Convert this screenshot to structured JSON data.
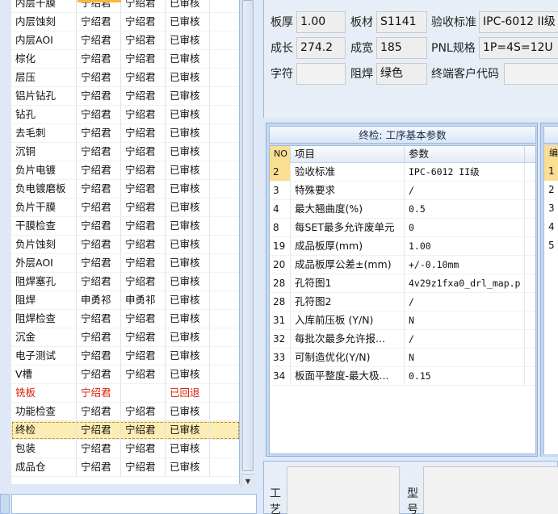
{
  "process_list": {
    "rows": [
      {
        "process": "内层干膜",
        "person1": "宁绍君",
        "person2": "宁绍君",
        "status": "已审核"
      },
      {
        "process": "内层蚀刻",
        "person1": "宁绍君",
        "person2": "宁绍君",
        "status": "已审核"
      },
      {
        "process": "内层AOI",
        "person1": "宁绍君",
        "person2": "宁绍君",
        "status": "已审核"
      },
      {
        "process": "棕化",
        "person1": "宁绍君",
        "person2": "宁绍君",
        "status": "已审核"
      },
      {
        "process": "层压",
        "person1": "宁绍君",
        "person2": "宁绍君",
        "status": "已审核"
      },
      {
        "process": "铝片钻孔",
        "person1": "宁绍君",
        "person2": "宁绍君",
        "status": "已审核"
      },
      {
        "process": "钻孔",
        "person1": "宁绍君",
        "person2": "宁绍君",
        "status": "已审核"
      },
      {
        "process": "去毛刺",
        "person1": "宁绍君",
        "person2": "宁绍君",
        "status": "已审核"
      },
      {
        "process": "沉铜",
        "person1": "宁绍君",
        "person2": "宁绍君",
        "status": "已审核"
      },
      {
        "process": "负片电镀",
        "person1": "宁绍君",
        "person2": "宁绍君",
        "status": "已审核"
      },
      {
        "process": "负电镀磨板",
        "person1": "宁绍君",
        "person2": "宁绍君",
        "status": "已审核"
      },
      {
        "process": "负片干膜",
        "person1": "宁绍君",
        "person2": "宁绍君",
        "status": "已审核"
      },
      {
        "process": "干膜检查",
        "person1": "宁绍君",
        "person2": "宁绍君",
        "status": "已审核"
      },
      {
        "process": "负片蚀刻",
        "person1": "宁绍君",
        "person2": "宁绍君",
        "status": "已审核"
      },
      {
        "process": "外层AOI",
        "person1": "宁绍君",
        "person2": "宁绍君",
        "status": "已审核"
      },
      {
        "process": "阻焊塞孔",
        "person1": "宁绍君",
        "person2": "宁绍君",
        "status": "已审核"
      },
      {
        "process": "阻焊",
        "person1": "申勇祁",
        "person2": "申勇祁",
        "status": "已审核"
      },
      {
        "process": "阻焊检查",
        "person1": "宁绍君",
        "person2": "宁绍君",
        "status": "已审核"
      },
      {
        "process": "沉金",
        "person1": "宁绍君",
        "person2": "宁绍君",
        "status": "已审核"
      },
      {
        "process": "电子测试",
        "person1": "宁绍君",
        "person2": "宁绍君",
        "status": "已审核"
      },
      {
        "process": "V槽",
        "person1": "宁绍君",
        "person2": "宁绍君",
        "status": "已审核"
      },
      {
        "process": "铣板",
        "person1": "宁绍君",
        "person2": "",
        "status": "已回退",
        "rejected": true
      },
      {
        "process": "功能检查",
        "person1": "宁绍君",
        "person2": "宁绍君",
        "status": "已审核"
      },
      {
        "process": "终检",
        "person1": "宁绍君",
        "person2": "宁绍君",
        "status": "已审核",
        "selected": true
      },
      {
        "process": "包装",
        "person1": "宁绍君",
        "person2": "宁绍君",
        "status": "已审核"
      },
      {
        "process": "成品仓",
        "person1": "宁绍君",
        "person2": "宁绍君",
        "status": "已审核"
      }
    ],
    "scroll_down_glyph": "▼"
  },
  "top_form": {
    "thickness_label": "板厚",
    "thickness_value": "1.00",
    "material_label": "板材",
    "material_value": "S1141",
    "standard_label": "验收标准",
    "standard_value": "IPC-6012 II级",
    "length_label": "成长",
    "length_value": "274.2",
    "width_label": "成宽",
    "width_value": "185",
    "pnl_label": "PNL规格",
    "pnl_value": "1P=4S=12U",
    "char_label": "字符",
    "char_value": "",
    "mask_label": "阻焊",
    "mask_value": "绿色",
    "customer_code_label": "终端客户代码",
    "customer_code_value": ""
  },
  "params_panel": {
    "title": "终检: 工序基本参数",
    "col_no": "NO",
    "col_item": "项目",
    "col_param": "参数",
    "rows": [
      {
        "no": "2",
        "item": "验收标准",
        "param": "IPC-6012 II级"
      },
      {
        "no": "3",
        "item": "特殊要求",
        "param": "/"
      },
      {
        "no": "4",
        "item": "最大翘曲度(%)",
        "param": "0.5"
      },
      {
        "no": "8",
        "item": "每SET最多允许废单元",
        "param": "0"
      },
      {
        "no": "19",
        "item": "成品板厚(mm)",
        "param": "1.00"
      },
      {
        "no": "20",
        "item": "成品板厚公差±(mm)",
        "param": "+/-0.10mm"
      },
      {
        "no": "28",
        "item": "孔符图1",
        "param": "4v29z1fxa0_drl_map.p"
      },
      {
        "no": "28",
        "item": "孔符图2",
        "param": "/"
      },
      {
        "no": "31",
        "item": "入库前压板 (Y/N)",
        "param": "N"
      },
      {
        "no": "32",
        "item": "每批次最多允许报...",
        "param": "/"
      },
      {
        "no": "33",
        "item": "可制造优化(Y/N)",
        "param": "N"
      },
      {
        "no": "34",
        "item": "板面平整度-最大极...",
        "param": "0.15"
      }
    ]
  },
  "side_panel": {
    "header": "编",
    "rows": [
      "1",
      "2",
      "3",
      "4",
      "5"
    ]
  },
  "bottom_panel": {
    "craft_label": "工艺",
    "model_label": "型号"
  }
}
